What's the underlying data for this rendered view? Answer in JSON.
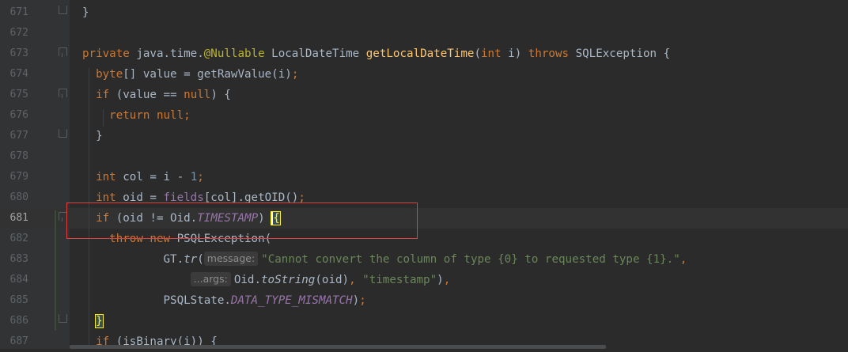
{
  "editor": {
    "lines": [
      {
        "num": "671",
        "segs": [
          {
            "t": "}",
            "c": ""
          }
        ]
      },
      {
        "num": "672",
        "segs": []
      },
      {
        "num": "673",
        "segs": [
          {
            "t": "private ",
            "c": "kw"
          },
          {
            "t": "java.time.",
            "c": ""
          },
          {
            "t": "@Nullable",
            "c": "ann"
          },
          {
            "t": " LocalDateTime ",
            "c": ""
          },
          {
            "t": "getLocalDateTime",
            "c": "fn"
          },
          {
            "t": "(",
            "c": ""
          },
          {
            "t": "int",
            "c": "kw"
          },
          {
            "t": " i) ",
            "c": ""
          },
          {
            "t": "throws",
            "c": "kw"
          },
          {
            "t": " SQLException {",
            "c": ""
          }
        ]
      },
      {
        "num": "674",
        "segs": [
          {
            "t": "  ",
            "c": ""
          },
          {
            "t": "byte",
            "c": "kw"
          },
          {
            "t": "[] value = getRawValue(i)",
            "c": ""
          },
          {
            "t": ";",
            "c": "kw"
          }
        ]
      },
      {
        "num": "675",
        "segs": [
          {
            "t": "  ",
            "c": ""
          },
          {
            "t": "if",
            "c": "kw"
          },
          {
            "t": " (value == ",
            "c": ""
          },
          {
            "t": "null",
            "c": "kw"
          },
          {
            "t": ") {",
            "c": ""
          }
        ]
      },
      {
        "num": "676",
        "segs": [
          {
            "t": "    ",
            "c": ""
          },
          {
            "t": "return null;",
            "c": "kw"
          }
        ]
      },
      {
        "num": "677",
        "segs": [
          {
            "t": "  }",
            "c": ""
          }
        ]
      },
      {
        "num": "678",
        "segs": []
      },
      {
        "num": "679",
        "segs": [
          {
            "t": "  ",
            "c": ""
          },
          {
            "t": "int",
            "c": "kw"
          },
          {
            "t": " col = i - ",
            "c": ""
          },
          {
            "t": "1",
            "c": "num"
          },
          {
            "t": ";",
            "c": "kw"
          }
        ]
      },
      {
        "num": "680",
        "segs": [
          {
            "t": "  ",
            "c": ""
          },
          {
            "t": "int",
            "c": "kw"
          },
          {
            "t": " oid = ",
            "c": ""
          },
          {
            "t": "fields",
            "c": "fld"
          },
          {
            "t": "[col].getOID()",
            "c": ""
          },
          {
            "t": ";",
            "c": "kw"
          }
        ]
      },
      {
        "num": "681",
        "current": true,
        "segs": [
          {
            "t": "  ",
            "c": ""
          },
          {
            "t": "if",
            "c": "kw"
          },
          {
            "t": " (oid != Oid.",
            "c": ""
          },
          {
            "t": "TIMESTAMP",
            "c": "fldi"
          },
          {
            "t": ") ",
            "c": ""
          },
          {
            "t": "{",
            "c": "brace-hl caret"
          }
        ]
      },
      {
        "num": "682",
        "segs": [
          {
            "t": "    ",
            "c": ""
          },
          {
            "t": "throw new ",
            "c": "kw"
          },
          {
            "t": "PSQLException(",
            "c": ""
          }
        ]
      },
      {
        "num": "683",
        "segs": [
          {
            "t": "            GT.",
            "c": ""
          },
          {
            "t": "tr",
            "c": "ital"
          },
          {
            "t": "(",
            "c": ""
          },
          {
            "hint": "message:"
          },
          {
            "t": "\"Cannot convert the column of type {0} to requested type {1}.\"",
            "c": "str"
          },
          {
            "t": ",",
            "c": "kw"
          }
        ]
      },
      {
        "num": "684",
        "segs": [
          {
            "t": "                ",
            "c": ""
          },
          {
            "hint": "...args:"
          },
          {
            "t": "Oid.",
            "c": ""
          },
          {
            "t": "toString",
            "c": "ital"
          },
          {
            "t": "(oid)",
            "c": ""
          },
          {
            "t": ", ",
            "c": "kw"
          },
          {
            "t": "\"timestamp\"",
            "c": "str"
          },
          {
            "t": ")",
            "c": ""
          },
          {
            "t": ",",
            "c": "kw"
          }
        ]
      },
      {
        "num": "685",
        "segs": [
          {
            "t": "            PSQLState.",
            "c": ""
          },
          {
            "t": "DATA_TYPE_MISMATCH",
            "c": "fldi"
          },
          {
            "t": ")",
            "c": ""
          },
          {
            "t": ";",
            "c": "kw"
          }
        ]
      },
      {
        "num": "686",
        "segs": [
          {
            "t": "  ",
            "c": ""
          },
          {
            "t": "}",
            "c": "brace-hl"
          }
        ]
      },
      {
        "num": "687",
        "segs": [
          {
            "t": "  ",
            "c": ""
          },
          {
            "t": "if",
            "c": "kw"
          },
          {
            "t": " (isBinary(i)) {",
            "c": ""
          }
        ]
      }
    ]
  },
  "colors": {
    "background": "#2b2b2b",
    "gutter": "#313335",
    "keyword": "#cc7832",
    "string": "#6a8759",
    "number": "#6897bb",
    "field": "#9876aa",
    "method": "#ffc66d",
    "annotation": "#bbb529",
    "highlight_box": "#e04040"
  }
}
